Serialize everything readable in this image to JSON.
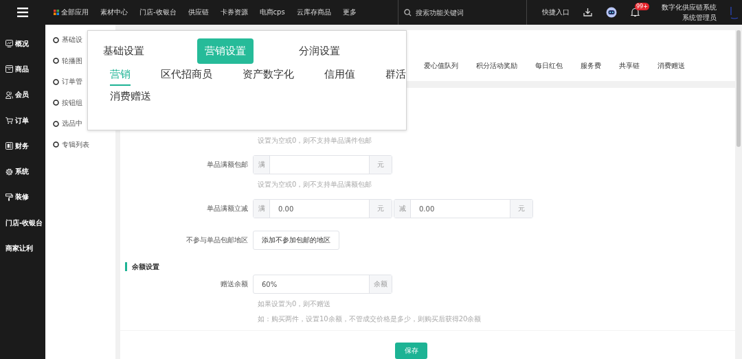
{
  "top_nav": {
    "apps": [
      {
        "label": "全部应用",
        "kind": "apps"
      },
      {
        "label": "素材中心"
      },
      {
        "label": "门店-收银台"
      },
      {
        "label": "供应链"
      },
      {
        "label": "卡券资源"
      },
      {
        "label": "电商cps"
      },
      {
        "label": "云库存商品"
      },
      {
        "label": "更多"
      }
    ],
    "search": {
      "placeholder": "搜索功能关键词"
    },
    "quick_entry": "快捷入口",
    "notification_badge": "99+",
    "system_name": "数字化供应链系统",
    "user_role": "系统管理员"
  },
  "sidebar": {
    "items": [
      {
        "label": "概况",
        "kind": "chart"
      },
      {
        "label": "商品",
        "kind": "box"
      },
      {
        "label": "会员",
        "kind": "people"
      },
      {
        "label": "订单",
        "kind": "cart"
      },
      {
        "label": "财务",
        "kind": "ledger"
      },
      {
        "label": "系统",
        "kind": "gear"
      },
      {
        "label": "装修",
        "kind": "roller"
      },
      {
        "label": "门店-收银台",
        "kind": "text"
      },
      {
        "label": "商家让利",
        "kind": "text"
      }
    ]
  },
  "submenu": {
    "items": [
      {
        "label": "基础设"
      },
      {
        "label": "轮播图"
      },
      {
        "label": "订单管"
      },
      {
        "label": "按钮组"
      },
      {
        "label": "选品中"
      },
      {
        "label": "专辑列表"
      }
    ]
  },
  "tabs": [
    {
      "label": "爱心值队列",
      "selected": false
    },
    {
      "label": "积分活动奖励",
      "selected": false
    },
    {
      "label": "每日红包",
      "selected": false
    },
    {
      "label": "服务费",
      "selected": false
    },
    {
      "label": "共享链",
      "selected": false
    },
    {
      "label": "消费赠送",
      "selected": false
    }
  ],
  "popup": {
    "main_tabs": [
      {
        "label": "基础设置",
        "selected": false
      },
      {
        "label": "营销设置",
        "selected": true
      },
      {
        "label": "分润设置",
        "selected": false
      }
    ],
    "sub_tab_rows": [
      {
        "tabs": [
          {
            "label": "营销",
            "selected": true
          },
          {
            "label": "区代招商员",
            "selected": false
          },
          {
            "label": "资产数字化",
            "selected": false
          },
          {
            "label": "信用值",
            "selected": false
          },
          {
            "label": "群活",
            "selected": false
          }
        ]
      },
      {
        "tabs": [
          {
            "label": "消费赠送",
            "selected": false
          }
        ]
      }
    ]
  },
  "form": {
    "items": [
      {
        "kind": "hint",
        "text": "设置为空或0，则不支持单品满件包邮"
      },
      {
        "kind": "input",
        "label": "单品满额包邮",
        "parts": [
          {
            "prefix": "满",
            "suffix": "元"
          }
        ]
      },
      {
        "kind": "hint",
        "text": "设置为空或0，则不支持单品满额包邮"
      },
      {
        "kind": "input",
        "label": "单品满额立减",
        "parts": [
          {
            "prefix": "满",
            "value": "0.00",
            "suffix": "元"
          },
          {
            "prefix": "减",
            "value": "0.00",
            "suffix": "元"
          }
        ]
      },
      {
        "kind": "button",
        "label": "不参与单品包邮地区",
        "button": "添加不参加包邮的地区"
      },
      {
        "kind": "section",
        "title": "余额设置"
      },
      {
        "kind": "input",
        "label": "赠送余额",
        "parts": [
          {
            "value": "60%",
            "suffix": "余额"
          }
        ]
      },
      {
        "kind": "hint",
        "text": "如果设置为0，则不赠送"
      },
      {
        "kind": "hint",
        "text": "如：购买两件，设置10余额，不管成交价格是多少，则购买后获得20余额"
      }
    ]
  },
  "save_button": "保存"
}
